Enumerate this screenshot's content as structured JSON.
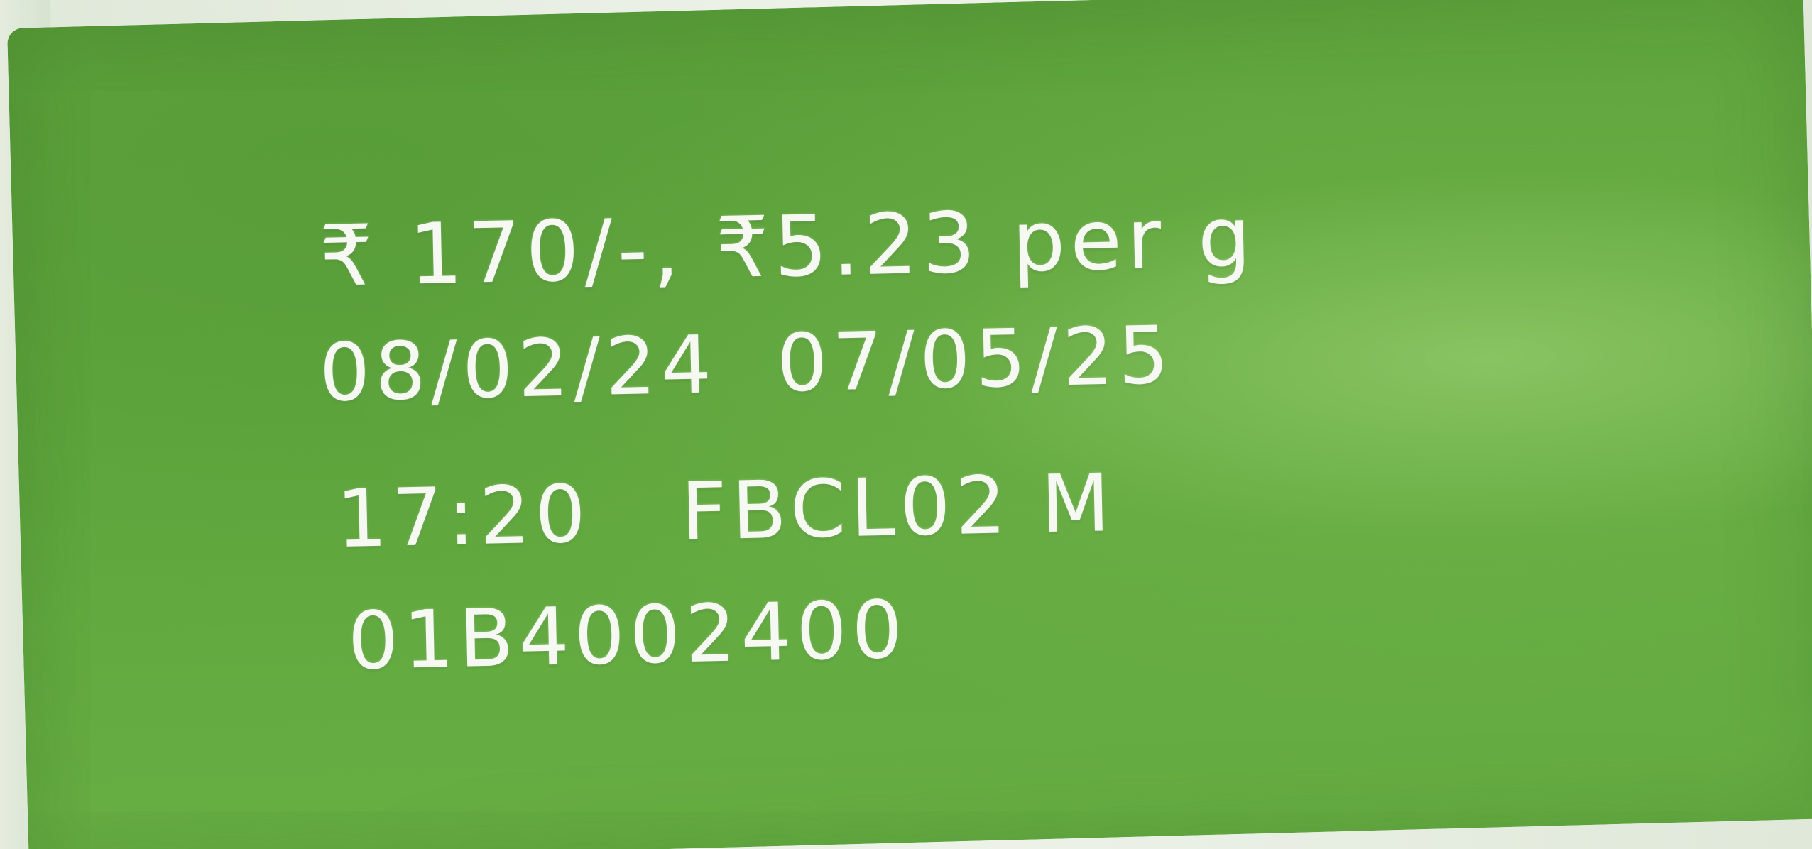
{
  "print": {
    "price_line": "₹ 170/-, ₹5.23 per g",
    "dates_line": "08/02/24  07/05/25",
    "batch_line": "17:20   FBCL02 M",
    "code_line": "01B4002400"
  },
  "colors": {
    "label_green": "#62a83f",
    "print_white": "#f5f9f1",
    "background_offwhite": "#e8efe3"
  }
}
